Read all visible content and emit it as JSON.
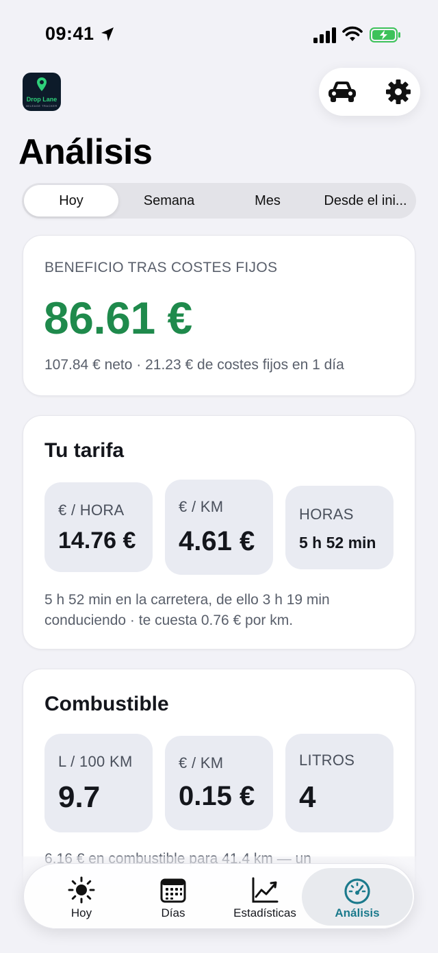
{
  "status_bar": {
    "time": "09:41"
  },
  "header": {
    "logo_text": "Drop Lane",
    "logo_subtext": "MILEAGE TRACKER"
  },
  "page": {
    "title": "Análisis"
  },
  "period_tabs": [
    {
      "label": "Hoy",
      "active": true
    },
    {
      "label": "Semana",
      "active": false
    },
    {
      "label": "Mes",
      "active": false
    },
    {
      "label": "Desde el ini...",
      "active": false
    }
  ],
  "profit": {
    "label": "BENEFICIO TRAS COSTES FIJOS",
    "value": "86.61 €",
    "detail": "107.84 € neto · 21.23 € de costes fijos en 1 día",
    "color": "#1f8a4c"
  },
  "rate": {
    "title": "Tu tarifa",
    "metrics": [
      {
        "label": "€ / HORA",
        "value": "14.76 €"
      },
      {
        "label": "€ / KM",
        "value": "4.61 €"
      },
      {
        "label": "HORAS",
        "value": "5 h 52 min"
      }
    ],
    "note": "5 h 52 min en la carretera, de ello 3 h 19 min conduciendo · te cuesta 0.76 € por km."
  },
  "fuel": {
    "title": "Combustible",
    "metrics": [
      {
        "label": "L / 100 KM",
        "value": "9.7"
      },
      {
        "label": "€ / KM",
        "value": "0.15 €"
      },
      {
        "label": "LITROS",
        "value": "4"
      }
    ],
    "note": "6.16 € en combustible para 41.4 km — un"
  },
  "tab_bar": [
    {
      "label": "Hoy",
      "icon": "sun-icon"
    },
    {
      "label": "Días",
      "icon": "calendar-icon"
    },
    {
      "label": "Estadísticas",
      "icon": "chart-line-icon"
    },
    {
      "label": "Análisis",
      "icon": "speedometer-icon",
      "active": true
    }
  ],
  "colors": {
    "accent": "#1b7a8c",
    "profit": "#1f8a4c",
    "background": "#f2f2f7"
  }
}
